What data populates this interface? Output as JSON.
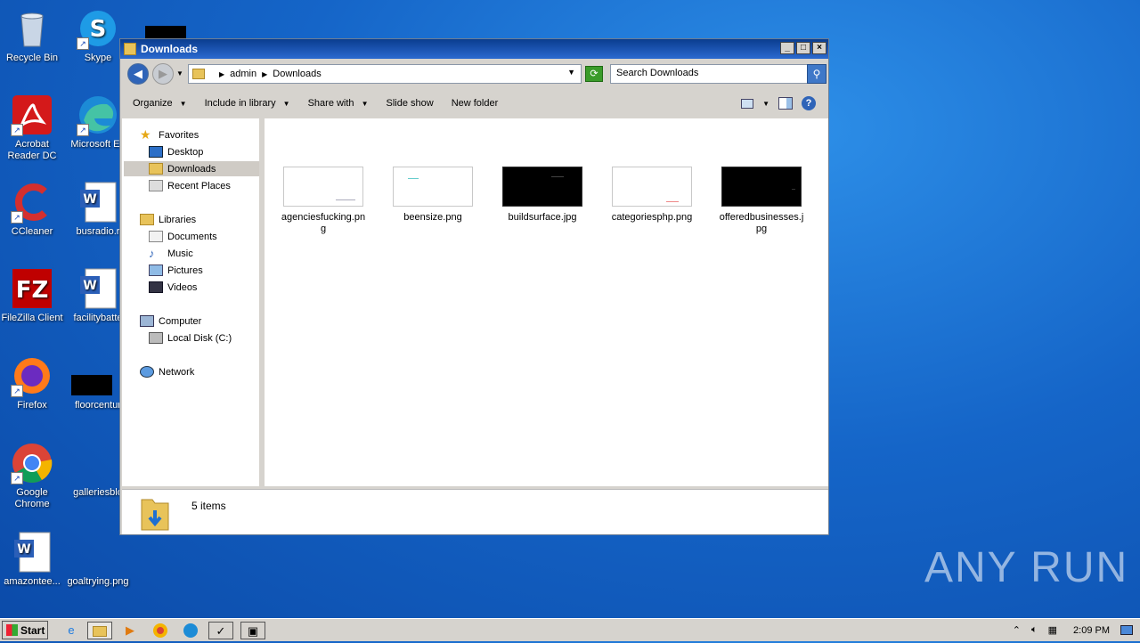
{
  "desktop": {
    "icons": [
      {
        "label": "Recycle Bin",
        "icon": "recycle-bin-icon"
      },
      {
        "label": "Skype",
        "icon": "skype-icon"
      },
      {
        "label": "Acrobat Reader DC",
        "icon": "acrobat-icon"
      },
      {
        "label": "Microsoft Edge",
        "icon": "edge-icon"
      },
      {
        "label": "CCleaner",
        "icon": "ccleaner-icon"
      },
      {
        "label": "busradio.rtf",
        "icon": "word-doc-icon"
      },
      {
        "label": "FileZilla Client",
        "icon": "filezilla-icon"
      },
      {
        "label": "facilitybattery.rtf",
        "icon": "word-doc-icon"
      },
      {
        "label": "Firefox",
        "icon": "firefox-icon"
      },
      {
        "label": "floorcentury",
        "icon": "image-file-icon"
      },
      {
        "label": "Google Chrome",
        "icon": "chrome-icon"
      },
      {
        "label": "galleriesblo",
        "icon": "image-file-icon"
      },
      {
        "label": "amazontee...",
        "icon": "word-doc-icon"
      },
      {
        "label": "goaltrying.png",
        "icon": "image-file-icon"
      }
    ],
    "display_labels": {
      "recycle": "Recycle Bin",
      "skype": "Skype",
      "acrobat_1": "Acrobat",
      "acrobat_2": "Reader DC",
      "edge": "Microsoft Ed",
      "ccleaner": "CCleaner",
      "busradio": "busradio.r",
      "filezilla": "FileZilla Client",
      "facility": "facilitybatte",
      "firefox": "Firefox",
      "floor": "floorcentur",
      "chrome_1": "Google",
      "chrome_2": "Chrome",
      "galleries": "galleriesblo",
      "amazon": "amazontee...",
      "goal": "goaltrying.png"
    },
    "watermark": "ANY RUN"
  },
  "window": {
    "title": "Downloads",
    "controls": {
      "minimize": "_",
      "maximize": "□",
      "close": "×"
    },
    "address": {
      "segments": [
        "admin",
        "Downloads"
      ]
    },
    "search_placeholder": "Search Downloads",
    "toolbar": {
      "organize": "Organize",
      "include": "Include in library",
      "share": "Share with",
      "slideshow": "Slide show",
      "newfolder": "New folder"
    },
    "nav": {
      "favorites": "Favorites",
      "desktop": "Desktop",
      "downloads": "Downloads",
      "recent": "Recent Places",
      "libraries": "Libraries",
      "documents": "Documents",
      "music": "Music",
      "pictures": "Pictures",
      "videos": "Videos",
      "computer": "Computer",
      "localdisk": "Local Disk (C:)",
      "network": "Network"
    },
    "files": [
      {
        "name": "agenciesfucking.png",
        "thumb": "light"
      },
      {
        "name": "beensize.png",
        "thumb": "light"
      },
      {
        "name": "buildsurface.jpg",
        "thumb": "dark"
      },
      {
        "name": "categoriesphp.png",
        "thumb": "light"
      },
      {
        "name": "offeredbusinesses.jpg",
        "thumb": "dark"
      }
    ],
    "status": "5 items"
  },
  "taskbar": {
    "start": "Start",
    "clock": "2:09 PM"
  },
  "colors": {
    "desktop_bg": "#1565c8",
    "titlebar": "#0a3d8f",
    "window_chrome": "#d6d3ce"
  }
}
